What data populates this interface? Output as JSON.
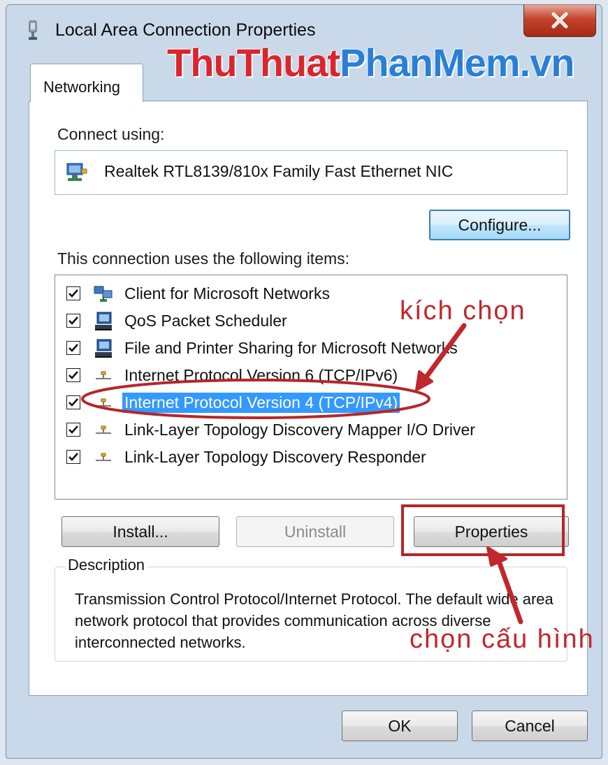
{
  "window": {
    "title": "Local Area Connection Properties",
    "close_glyph": "X"
  },
  "watermark": {
    "part1": "ThuThuat",
    "part2": "PhanMem.vn"
  },
  "tabs": [
    {
      "label": "Networking",
      "active": true
    }
  ],
  "connect_using": {
    "label": "Connect using:",
    "adapter": "Realtek RTL8139/810x Family Fast Ethernet NIC",
    "configure_button": "Configure..."
  },
  "items_section": {
    "label": "This connection uses the following items:",
    "items": [
      {
        "label": "Client for Microsoft Networks",
        "checked": true,
        "icon": "network-client-icon",
        "selected": false
      },
      {
        "label": "QoS Packet Scheduler",
        "checked": true,
        "icon": "computer-service-icon",
        "selected": false
      },
      {
        "label": "File and Printer Sharing for Microsoft Networks",
        "checked": true,
        "icon": "computer-service-icon",
        "selected": false
      },
      {
        "label": "Internet Protocol Version 6 (TCP/IPv6)",
        "checked": true,
        "icon": "protocol-icon",
        "selected": false
      },
      {
        "label": "Internet Protocol Version 4 (TCP/IPv4)",
        "checked": true,
        "icon": "protocol-icon",
        "selected": true
      },
      {
        "label": "Link-Layer Topology Discovery Mapper I/O Driver",
        "checked": true,
        "icon": "protocol-icon",
        "selected": false
      },
      {
        "label": "Link-Layer Topology Discovery Responder",
        "checked": true,
        "icon": "protocol-icon",
        "selected": false
      }
    ]
  },
  "buttons": {
    "install": "Install...",
    "uninstall": "Uninstall",
    "properties": "Properties",
    "ok": "OK",
    "cancel": "Cancel"
  },
  "description": {
    "legend": "Description",
    "text": "Transmission Control Protocol/Internet Protocol. The default wide area network protocol that provides communication across diverse interconnected networks."
  },
  "annotations": {
    "select_item": "kích chọn",
    "select_config": "chọn cấu hình"
  },
  "colors": {
    "annotation_red": "#c1272d",
    "selection_blue": "#3399ff",
    "watermark_red": "#d9262e",
    "watermark_blue": "#2a7fd4"
  }
}
